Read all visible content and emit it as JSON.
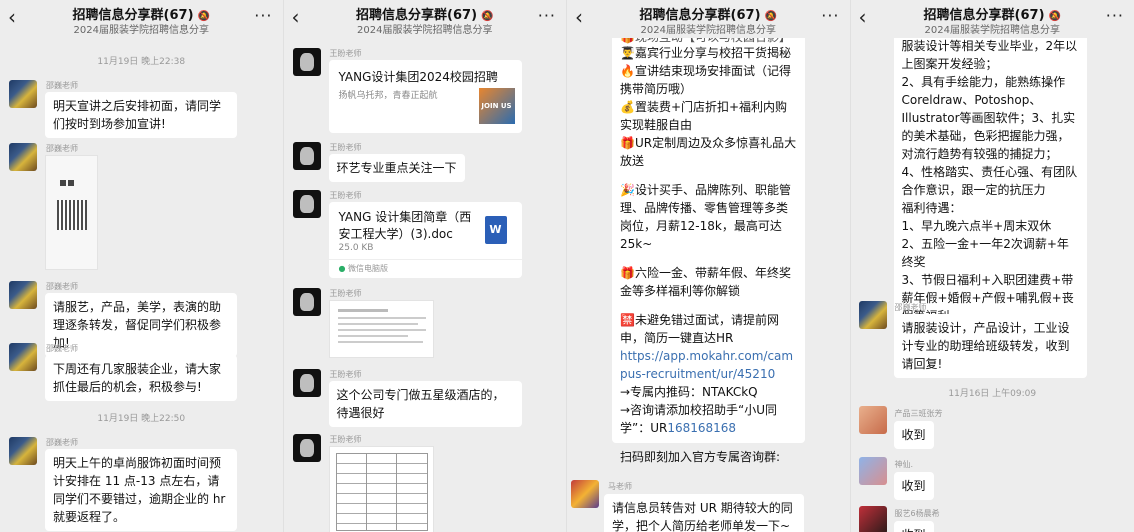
{
  "header": {
    "back_glyph": "‹",
    "title": "招聘信息分享群(67)",
    "subtitle": "2024届服装学院招聘信息分享",
    "more_glyph": "···"
  },
  "icons": {
    "back": "chevron-left-icon",
    "more": "more-icon",
    "mute": "mute-bell-icon"
  },
  "panel1": {
    "ts1": "11月19日 晚上22:38",
    "ts2": "11月19日 晚上22:50",
    "sender": "邵巍老师",
    "msg1": "明天宣讲之后安排初面，请同学们按时到场参加宣讲!",
    "msg3": "请服艺，产品，美学，表演的助理逐条转发，督促同学们积极参加!",
    "msg4": "下周还有几家服装企业，请大家抓住最后的机会，积极参与!",
    "msg5": "明天上午的卓尚服饰初面时间预计安排在 11 点-13 点左右，请同学们不要错过，逾期企业的 hr 就要返程了。"
  },
  "panel2": {
    "sender": "王盼老师",
    "link_title": "YANG设计集团2024校园招聘",
    "link_desc": "扬帆乌托邦，青春正起航",
    "link_thumb": "JOIN US",
    "msg2": "环艺专业重点关注一下",
    "file_name": "YANG 设计集团简章（西安工程大学）(3).doc",
    "file_size": "25.0 KB",
    "file_source": "微信电脑版",
    "file_icon": "W",
    "msg5": "这个公司专门做五星级酒店的，待遇很好"
  },
  "panel3": {
    "top_line": "🎁现场互动【可以与校园合影】",
    "lines": [
      "👨‍🎓嘉宾行业分享与校招干货揭秘",
      "🔥宣讲结束现场安排面试（记得携带简历哦）",
      "💰置装费+门店折扣+福利内购实现鞋服自由",
      "🎁UR定制周边及众多惊喜礼品大放送"
    ],
    "para2": "🎉设计买手、品牌陈列、职能管理、品牌传播、零售管理等多类岗位，月薪12-18k，最高可达25k~",
    "para3": "🎁六险一金、带薪年假、年终奖金等多样福利等你解锁",
    "para4_pre": "🈲未避免错过面试，请提前网申，简历一键直达HR",
    "url": "https://app.mokahr.com/campus-recruitment/ur/45210",
    "code_line": "→专属内推码：NTAKCkQ",
    "helper_pre": "→咨询请添加校招助手“小U同学”：UR",
    "helper_num": "168168168",
    "scan_line": "扫码即刻加入官方专属咨询群:",
    "sender2": "马老师",
    "msg2": "请信息员转告对 UR 期待较大的同学，把个人简历给老师单发一下~"
  },
  "panel4": {
    "text_top": "服装设计等相关专业毕业，2年以上图案开发经验；\n2、具有手绘能力，能熟练操作Coreldraw、Potoshop、Illustrator等画图软件；3、扎实的美术基础，色彩把握能力强，对流行趋势有较强的捕捉力；\n4、性格踏实、责任心强、有团队合作意识，跟一定的抗压力\n福利待遇：\n1、早九晚六点半+周末双休\n2、五险一金+一年2次调薪+年终奖\n3、节假日福利+入职团建费+带薪年假+婚假+产假+哺乳假+丧假等福利",
    "sender": "邵巍老师",
    "msg2": "请服装设计，产品设计，工业设计专业的助理给班级转发，收到请回复!",
    "ts": "11月16日 上午09:09",
    "r1_name": "产品三班张芳",
    "r1_msg": "收到",
    "r2_name": "神仙.",
    "r2_msg": "收到",
    "r3_name": "服艺6杨晨希",
    "r3_msg": "收到"
  }
}
